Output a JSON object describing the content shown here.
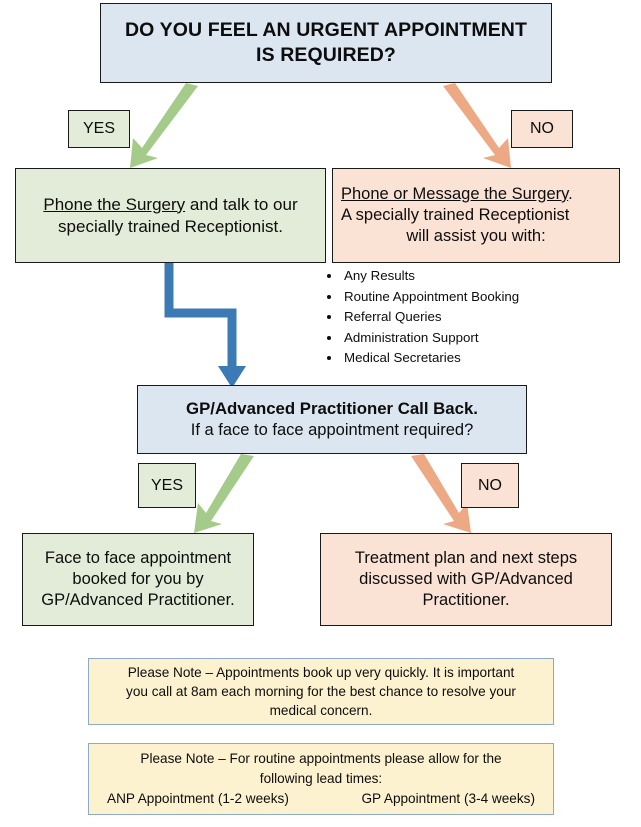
{
  "title": {
    "line1": "DO YOU FEEL AN URGENT APPOINTMENT",
    "line2": "IS REQUIRED?"
  },
  "labels": {
    "yes_top": "YES",
    "no_top": "NO",
    "yes_bottom": "YES",
    "no_bottom": "NO"
  },
  "urgent_path": {
    "emphasis": "Phone the Surgery",
    "rest": " and talk to our specially trained Receptionist."
  },
  "routine_path": {
    "emphasis": "Phone or Message the Surgery",
    "emphasis_tail": ".",
    "line2": "A specially trained Receptionist",
    "line3": "will assist you with:",
    "services": [
      "Any Results",
      "Routine Appointment Booking",
      "Referral Queries",
      "Administration Support",
      "Medical Secretaries"
    ]
  },
  "callback": {
    "heading": "GP/Advanced Practitioner Call Back.",
    "question": "If a face to face appointment required?"
  },
  "outcomes": {
    "yes_line1": "Face to face appointment",
    "yes_line2": "booked for you by",
    "yes_line3": "GP/Advanced Practitioner.",
    "no_line1": "Treatment plan and next steps",
    "no_line2": "discussed with GP/Advanced",
    "no_line3": "Practitioner."
  },
  "notes": {
    "note1_line1": "Please Note – Appointments book up very quickly. It is important",
    "note1_line2": "you call at 8am each morning for the best chance to resolve your",
    "note1_line3": "medical concern.",
    "note2_line1": "Please Note – For routine appointments please allow for the",
    "note2_line2": "following lead times:",
    "note2_left": "ANP Appointment (1-2 weeks)",
    "note2_right": "GP Appointment (3-4 weeks)"
  },
  "colors": {
    "blue_fill": "#dce6f1",
    "green_fill": "#e3ecd9",
    "peach_fill": "#fae2d4",
    "cream_fill": "#fdf2cf",
    "green_arrow": "#a4cb8a",
    "peach_arrow": "#eda983",
    "blue_arrow": "#3b7ab5",
    "border": "#1a1a1a",
    "cream_border": "#8fa9c8"
  }
}
